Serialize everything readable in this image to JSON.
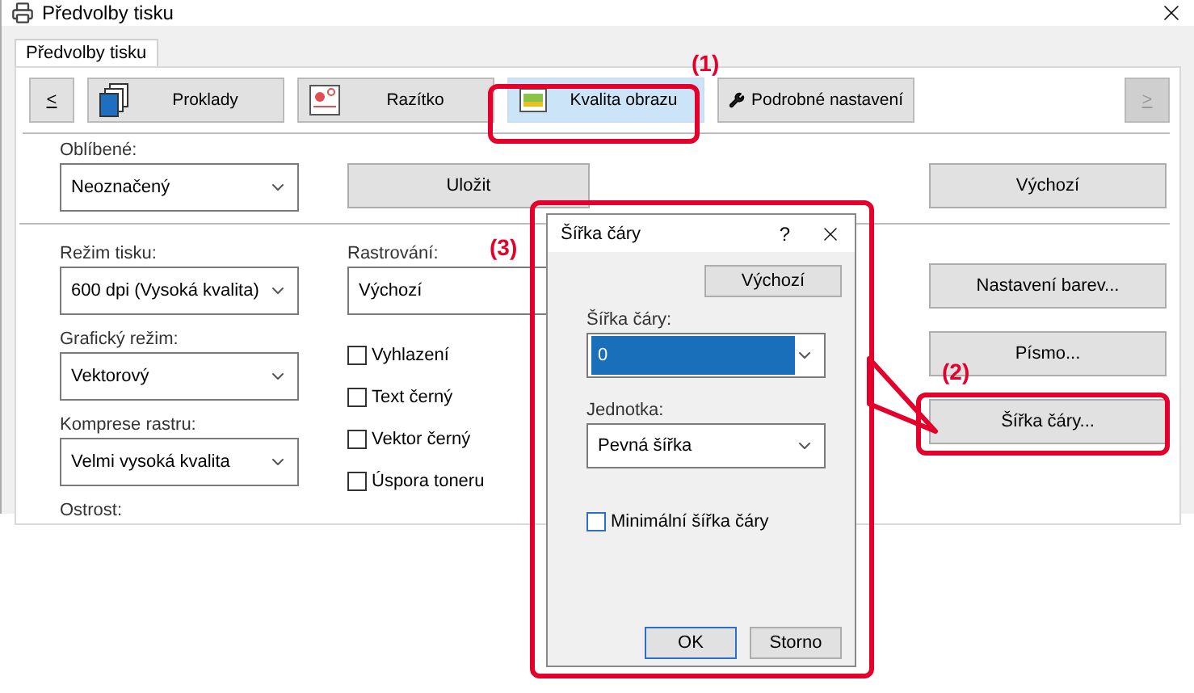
{
  "window": {
    "title": "Předvolby tisku"
  },
  "tabs": [
    {
      "label": "Předvolby tisku",
      "selected": true
    }
  ],
  "nav": {
    "prev": "<",
    "next": ">",
    "next_disabled": true
  },
  "categories": [
    {
      "label": "Proklady",
      "selected": false
    },
    {
      "label": "Razítko",
      "selected": false
    },
    {
      "label": "Kvalita obrazu",
      "selected": true
    },
    {
      "label": "Podrobné nastavení",
      "selected": false
    }
  ],
  "favorites": {
    "label": "Oblíbené:",
    "value": "Neoznačený"
  },
  "save_button": "Uložit",
  "default_button": "Výchozí",
  "left_fields": [
    {
      "label": "Režim tisku:",
      "value": "600 dpi (Vysoká kvalita)"
    },
    {
      "label": "Grafický režim:",
      "value": "Vektorový"
    },
    {
      "label": "Komprese rastru:",
      "value": "Velmi vysoká kvalita"
    }
  ],
  "cut_label": "Ostrost:",
  "rastering": {
    "label": "Rastrování:",
    "value": "Výchozí"
  },
  "checkboxes": [
    {
      "label": "Vyhlazení",
      "checked": false
    },
    {
      "label": "Text černý",
      "checked": false
    },
    {
      "label": "Vektor černý",
      "checked": false
    },
    {
      "label": "Úspora toneru",
      "checked": false
    }
  ],
  "right_buttons": [
    "Nastavení barev...",
    "Písmo...",
    "Šířka čáry..."
  ],
  "dialog": {
    "title": "Šířka čáry",
    "help": "?",
    "default_button": "Výchozí",
    "width_field": {
      "label": "Šířka čáry:",
      "value": "0"
    },
    "unit_field": {
      "label": "Jednotka:",
      "value": "Pevná šířka"
    },
    "min_width": {
      "label": "Minimální šířka čáry",
      "checked": false
    },
    "buttons": [
      "OK",
      "Storno"
    ]
  },
  "callouts": [
    "(1)",
    "(2)",
    "(3)"
  ]
}
